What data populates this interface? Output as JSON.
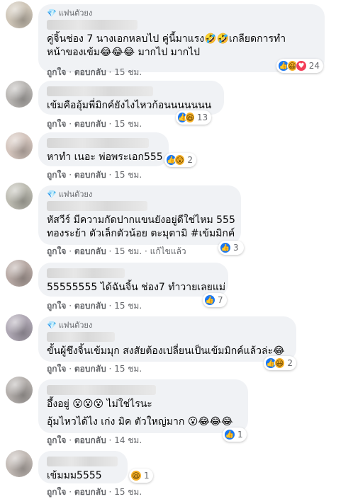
{
  "actions": {
    "like": "ถูกใจ",
    "reply": "ตอบกลับ",
    "edited": "แก้ไขแล้ว"
  },
  "badge": "แฟนตัวยง",
  "comments": [
    {
      "text_lines": [
        "คู่จิ้นช่อง 7 นางเอกหลบไป คู่นี้มาแรง🤣🤣เกลียดการทำ",
        "หน้าของเข้ม😂😂😂 มากไป มากไป"
      ],
      "time": "15 ชม.",
      "reactions": [
        "like",
        "haha",
        "love"
      ],
      "count": "24"
    },
    {
      "text_lines": [
        "เข้มคืออุ้มพี่มิกค์ยังไงไหวก้อนนนนนนน"
      ],
      "time": "15 ชม.",
      "reactions": [
        "like",
        "haha"
      ],
      "count": "13"
    },
    {
      "text_lines": [
        "หาทำ เนอะ พ่อพระเอก555"
      ],
      "time": "15 ชม.",
      "reactions": [
        "like",
        "wow"
      ],
      "count": "2"
    },
    {
      "text_lines": [
        "หัสวีร์ มีความกัดปากแขนยังอยู่ดีใช่ไหม 555",
        "ทองระย้า ตัวเล็กตัวน้อย ตะมุตามิ #เข้มมิกค์"
      ],
      "time": "15 ชม.",
      "reactions": [
        "like"
      ],
      "count": "3"
    },
    {
      "text_lines": [
        "55555555 ได้ฉันจิ้น ช่อง7 ทำวายเลยแม่"
      ],
      "time": "15 ชม.",
      "reactions": [
        "like"
      ],
      "count": "7"
    },
    {
      "text_lines": [
        "ขั้นผู้ชึงจิ้นเข้มมุก สงสัยต้องเปลี่ยนเป็นเข้มมิกค์แล้วล่ะ😂"
      ],
      "time": "15 ชม.",
      "reactions": [
        "like",
        "haha"
      ],
      "count": "2"
    },
    {
      "text_lines": [
        "อึ้งอยู่ 😮😮😮 ไม่ใช่ไรนะ",
        "อุ้มไหวได้ไง เก่ง มิค ตัวใหญ่มาก 😮😂😂😂"
      ],
      "time": "14 ชม.",
      "reactions": [
        "like"
      ],
      "count": "1"
    },
    {
      "text_lines": [
        "เข้มมม5555"
      ],
      "time": "15 ชม.",
      "reactions": [
        "haha"
      ],
      "count": "1"
    }
  ]
}
